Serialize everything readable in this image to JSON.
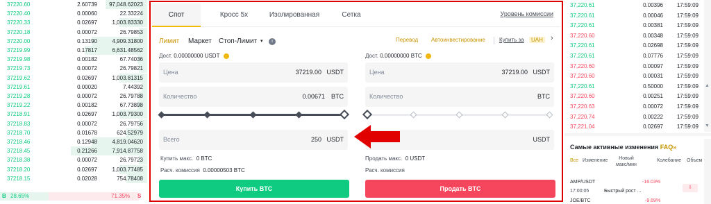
{
  "orderbook": {
    "rows": [
      {
        "price": "37220.60",
        "amount": "2.60739",
        "total": "97,048.62023"
      },
      {
        "price": "37220.40",
        "amount": "0.00060",
        "total": "22.33224"
      },
      {
        "price": "37220.33",
        "amount": "0.02697",
        "total": "1,003.83330"
      },
      {
        "price": "37220.18",
        "amount": "0.00072",
        "total": "26.79853"
      },
      {
        "price": "37220.00",
        "amount": "0.13190",
        "total": "4,909.31800"
      },
      {
        "price": "37219.99",
        "amount": "0.17817",
        "total": "6,631.48562"
      },
      {
        "price": "37219.98",
        "amount": "0.00182",
        "total": "67.74036"
      },
      {
        "price": "37219.73",
        "amount": "0.00072",
        "total": "26.79821"
      },
      {
        "price": "37219.62",
        "amount": "0.02697",
        "total": "1,003.81315"
      },
      {
        "price": "37219.61",
        "amount": "0.00020",
        "total": "7.44392"
      },
      {
        "price": "37219.28",
        "amount": "0.00072",
        "total": "26.79788"
      },
      {
        "price": "37219.22",
        "amount": "0.00182",
        "total": "67.73898"
      },
      {
        "price": "37218.91",
        "amount": "0.02697",
        "total": "1,003.79300"
      },
      {
        "price": "37218.83",
        "amount": "0.00072",
        "total": "26.79756"
      },
      {
        "price": "37218.70",
        "amount": "0.01678",
        "total": "624.52979"
      },
      {
        "price": "37218.46",
        "amount": "0.12948",
        "total": "4,819.04620"
      },
      {
        "price": "37218.45",
        "amount": "0.21266",
        "total": "7,914.87758"
      },
      {
        "price": "37218.38",
        "amount": "0.00072",
        "total": "26.79723"
      },
      {
        "price": "37218.20",
        "amount": "0.02697",
        "total": "1,003.77485"
      },
      {
        "price": "37218.15",
        "amount": "0.02028",
        "total": "754.78408"
      }
    ],
    "buy_label": "B",
    "buy_pct": "28.65%",
    "sell_pct": "71.35%",
    "sell_label": "S"
  },
  "panel": {
    "tabs": [
      "Спот",
      "Кросс 5x",
      "Изолированная",
      "Сетка"
    ],
    "fee_link": "Уровень комиссии",
    "order_types": [
      "Лимит",
      "Маркет",
      "Стоп-Лимит"
    ],
    "info_icon": "i",
    "transfer": "Перевод",
    "autoinvest": "Автоинвестирование",
    "buy_with": "Купить за",
    "buy_with_currency": "UAH",
    "chevron": "›",
    "buy": {
      "avail_label": "Дост.",
      "avail_value": "0.00000000 USDT",
      "price_label": "Цена",
      "price_value": "37219.00",
      "price_unit": "USDT",
      "qty_label": "Количество",
      "qty_value": "0.00671",
      "qty_unit": "BTC",
      "total_label": "Всего",
      "total_value": "250",
      "total_unit": "USDT",
      "max_label": "Купить макс.",
      "max_value": "0 BTC",
      "fee_label": "Расч. комиссия",
      "fee_value": "0.00000503 BTC",
      "button": "Купить BTC",
      "slider_pct": 100
    },
    "sell": {
      "avail_label": "Дост.",
      "avail_value": "0.00000000 BTC",
      "price_label": "Цена",
      "price_value": "37219.00",
      "price_unit": "USDT",
      "qty_label": "Количество",
      "qty_unit": "BTC",
      "total_unit": "USDT",
      "max_label": "Продать макс.",
      "max_value": "0 USDT",
      "fee_label": "Расч. комиссия",
      "button": "Продать BTC",
      "slider_pct": 0
    }
  },
  "trades": {
    "rows": [
      {
        "price": "37,220.61",
        "amount": "0.00396",
        "time": "17:59:09",
        "dir": "up"
      },
      {
        "price": "37,220.61",
        "amount": "0.00046",
        "time": "17:59:09",
        "dir": "up"
      },
      {
        "price": "37,220.61",
        "amount": "0.00381",
        "time": "17:59:09",
        "dir": "up"
      },
      {
        "price": "37,220.60",
        "amount": "0.00348",
        "time": "17:59:09",
        "dir": "down"
      },
      {
        "price": "37,220.61",
        "amount": "0.02698",
        "time": "17:59:09",
        "dir": "up"
      },
      {
        "price": "37,220.61",
        "amount": "0.07776",
        "time": "17:59:09",
        "dir": "up"
      },
      {
        "price": "37,220.60",
        "amount": "0.00097",
        "time": "17:59:09",
        "dir": "down"
      },
      {
        "price": "37,220.60",
        "amount": "0.00031",
        "time": "17:59:09",
        "dir": "down"
      },
      {
        "price": "37,220.61",
        "amount": "0.50000",
        "time": "17:59:09",
        "dir": "up"
      },
      {
        "price": "37,220.60",
        "amount": "0.00251",
        "time": "17:59:09",
        "dir": "down"
      },
      {
        "price": "37,220.63",
        "amount": "0.00072",
        "time": "17:59:09",
        "dir": "down"
      },
      {
        "price": "37,220.74",
        "amount": "0.00222",
        "time": "17:59:09",
        "dir": "down"
      },
      {
        "price": "37,221.04",
        "amount": "0.02697",
        "time": "17:59:09",
        "dir": "down"
      }
    ],
    "scroll_up": "▲",
    "scroll_down": "▼"
  },
  "movers": {
    "title": "Самые активные изменения",
    "faq": "FAQ",
    "faq_arrow": "»",
    "tabs": [
      "Все",
      "Изменение",
      "Новый макс/мин",
      "Колебание",
      "Объем"
    ],
    "rows": [
      {
        "pair": "AMP/USDT",
        "change": "-16.03%"
      },
      {
        "time": "17:00:05",
        "text": "Быстрый рост ..."
      },
      {
        "pair": "JOE/BTC",
        "change": "-9.69%"
      }
    ],
    "icon": "⇩"
  },
  "colors": {
    "green": "#0ecb81",
    "red": "#f6465d",
    "highlight": "#e00000",
    "accent": "#f0b90b"
  }
}
